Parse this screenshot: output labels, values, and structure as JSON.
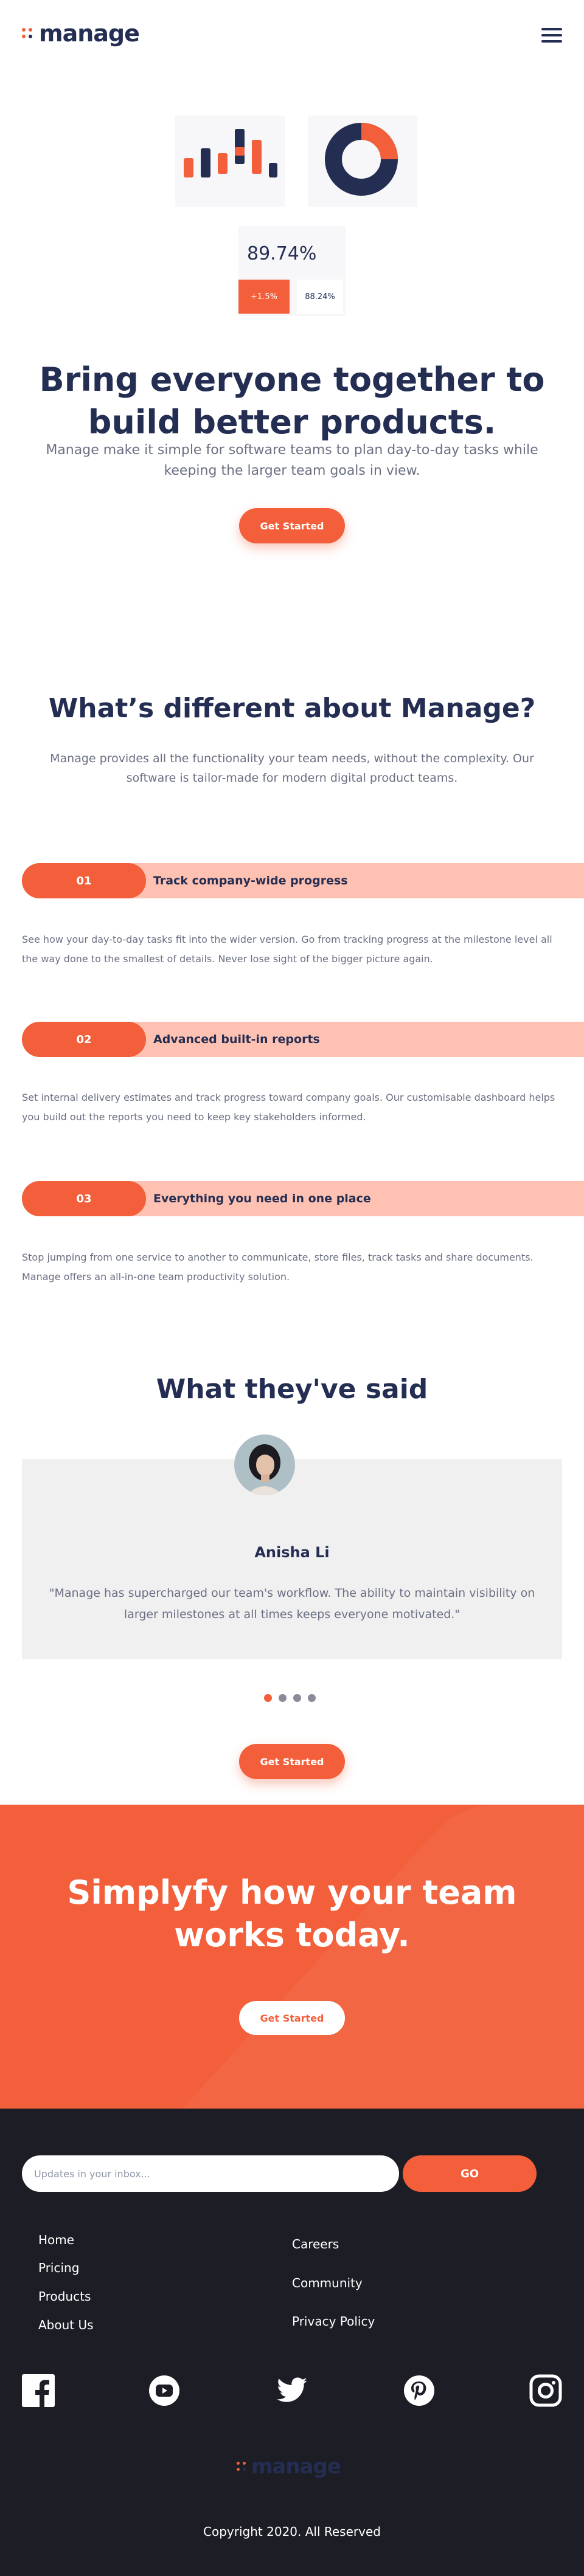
{
  "brand": {
    "name": "manage",
    "accent": "#f25f3a",
    "dark": "#242d52",
    "footer_bg": "#1d1e25"
  },
  "header": {
    "menu_icon": "hamburger-icon"
  },
  "hero": {
    "stat_value": "89.74%",
    "stat_change": "+1.5%",
    "stat_secondary": "88.24%",
    "title": "Bring everyone together to build better products.",
    "text": "Manage make it simple for software teams to plan day-to-day tasks while keeping the larger team goals in view.",
    "cta": "Get Started"
  },
  "different": {
    "title": "What’s different about Manage?",
    "text": "Manage provides all the functionality your team needs, without the complexity. Our software is tailor-made for modern digital product teams.",
    "features": [
      {
        "num": "01",
        "title": "Track company-wide progress",
        "text": "See how your day-to-day tasks fit into the wider version. Go from tracking progress at the milestone level all the way done to the smallest of details. Never lose sight of the bigger picture again."
      },
      {
        "num": "02",
        "title": "Advanced built-in reports",
        "text": "Set internal delivery estimates and track progress toward company goals. Our customisable dashboard helps you build out the reports you need to keep key stakeholders informed."
      },
      {
        "num": "03",
        "title": "Everything you need in one place",
        "text": "Stop jumping from one service to another to communicate, store files, track tasks and share documents. Manage offers an all-in-one team productivity solution."
      }
    ]
  },
  "testimonials": {
    "title": "What they've said",
    "name": "Anisha Li",
    "quote": "\"Manage has supercharged our team's workflow. The ability to maintain visibility on larger milestones at all times keeps everyone motivated.\"",
    "cta": "Get Started"
  },
  "cta": {
    "title": "Simplyfy how your team works today.",
    "button": "Get Started"
  },
  "footer": {
    "newsletter_placeholder": "Updates in your inbox...",
    "go": "GO",
    "links_left": [
      "Home",
      "Pricing",
      "Products",
      "About Us"
    ],
    "links_right": [
      "Careers",
      "Community",
      "Privacy Policy"
    ],
    "social": [
      "facebook-icon",
      "youtube-icon",
      "twitter-icon",
      "pinterest-icon",
      "instagram-icon"
    ],
    "copyright": "Copyright 2020. All Reserved"
  }
}
